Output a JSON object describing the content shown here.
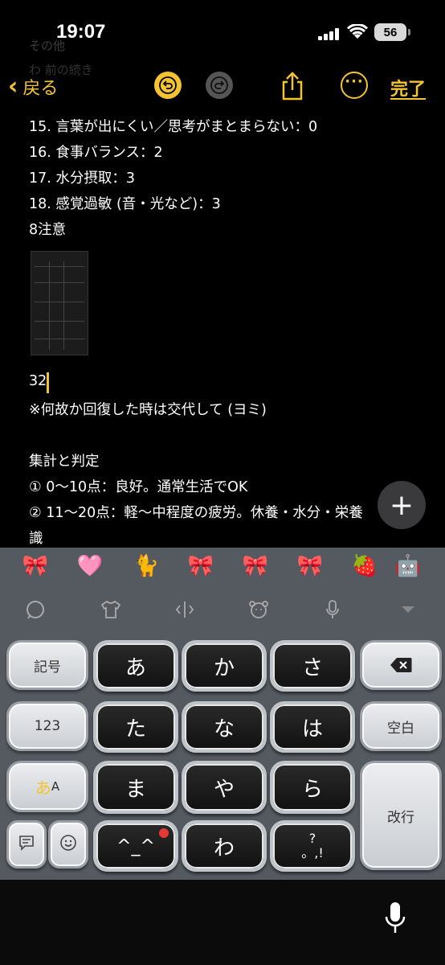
{
  "status": {
    "time": "19:07",
    "battery": "56"
  },
  "toolbar": {
    "back_label": "戻る",
    "done_label": "完了"
  },
  "ghost": {
    "line1": "その他",
    "line2": "わ   前の続き"
  },
  "note": {
    "lines": [
      "15. 言葉が出にくい／思考がまとまらない：0",
      "16. 食事バランス：2",
      "17. 水分摂取：3",
      "18. 感覚過敏 (音・光など)：3",
      "8注意"
    ],
    "number": "32",
    "remark": "※何故か回復した時は交代して (ヨミ)",
    "section_title": "集計と判定",
    "judge1": "① 0〜10点：良好。通常生活でOK",
    "judge2": "② 11〜20点：軽〜中程度の疲労。休養・水分・栄養",
    "judge2_cont": "識"
  },
  "emoji_bar": [
    "🎀",
    "🩷",
    "🐈",
    "🎀",
    "🎀",
    "🎀",
    "🍓",
    "🤖"
  ],
  "keyboard": {
    "kigou": "記号",
    "num": "123",
    "mode": "あ",
    "mode_small": "A",
    "space": "空白",
    "enter": "改行",
    "kana": [
      "あ",
      "か",
      "さ",
      "た",
      "な",
      "は",
      "ま",
      "や",
      "ら",
      "^_^",
      "わ",
      "、。?!"
    ],
    "punct_top": "?",
    "punct_bottom": "。,!"
  }
}
